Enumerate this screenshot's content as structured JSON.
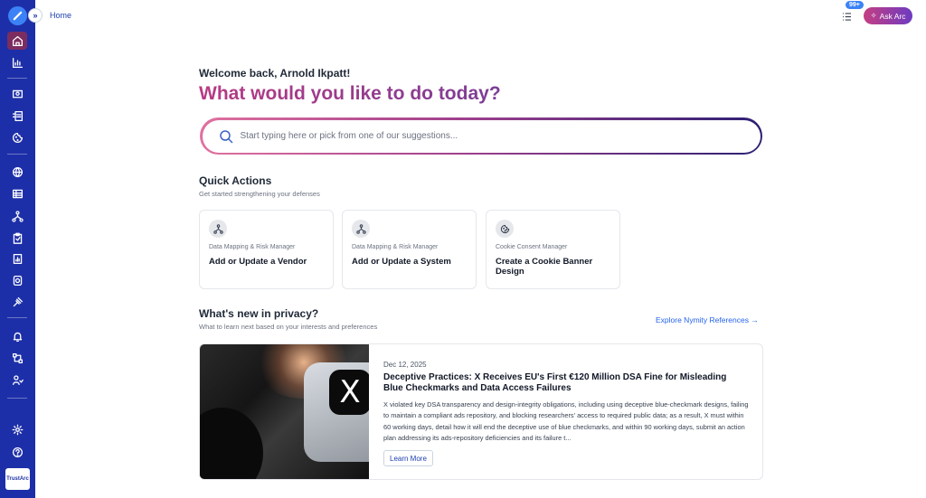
{
  "sidebar": {
    "items": [
      {
        "name": "home",
        "icon": "home-icon",
        "active": true
      },
      {
        "name": "analytics",
        "icon": "bar-chart-icon"
      },
      {
        "name": "monitor",
        "icon": "monitor-icon"
      },
      {
        "name": "reports",
        "icon": "document-icon"
      },
      {
        "name": "cookies",
        "icon": "cookie-icon"
      },
      {
        "name": "privacy",
        "icon": "globe-icon"
      },
      {
        "name": "table",
        "icon": "table-icon"
      },
      {
        "name": "data-mapping",
        "icon": "network-icon"
      },
      {
        "name": "assessments",
        "icon": "clipboard-icon"
      },
      {
        "name": "files",
        "icon": "file-chart-icon"
      },
      {
        "name": "consent",
        "icon": "shield-icon"
      },
      {
        "name": "legal",
        "icon": "gavel-icon"
      },
      {
        "name": "notifications",
        "icon": "bell-icon"
      },
      {
        "name": "workflows",
        "icon": "workflow-icon"
      },
      {
        "name": "users",
        "icon": "users-icon"
      },
      {
        "name": "settings",
        "icon": "gear-icon"
      },
      {
        "name": "help",
        "icon": "help-icon"
      }
    ],
    "brand": "TrustArc"
  },
  "header": {
    "breadcrumb": "Home",
    "notification_badge": "99+",
    "ask_label": "Ask Arc"
  },
  "hero": {
    "welcome": "Welcome back, Arnold Ikpatt!",
    "headline": "What would you like to do today?",
    "search_placeholder": "Start typing here or pick from one of our suggestions..."
  },
  "quick_actions": {
    "title": "Quick Actions",
    "subtitle": "Get started strengthening your defenses",
    "cards": [
      {
        "category": "Data Mapping & Risk Manager",
        "title": "Add or Update a Vendor",
        "icon": "network-icon"
      },
      {
        "category": "Data Mapping & Risk Manager",
        "title": "Add or Update a System",
        "icon": "network-icon"
      },
      {
        "category": "Cookie Consent Manager",
        "title": "Create a Cookie Banner Design",
        "icon": "cookie-icon"
      }
    ]
  },
  "news": {
    "title": "What's new in privacy?",
    "subtitle": "What to learn next based on your interests and preferences",
    "explore_label": "Explore Nymity References",
    "article": {
      "date": "Dec 12, 2025",
      "headline": "Deceptive Practices: X Receives EU's First €120 Million DSA Fine for Misleading Blue Checkmarks and Data Access Failures",
      "body": "X violated key DSA transparency and design-integrity obligations, including using deceptive blue-checkmark designs, failing to maintain a compliant ads repository, and blocking researchers' access to required public data; as a result, X must within 60 working days, detail how it will end the deceptive use of blue checkmarks, and within 90 working days, submit an action plan addressing its ads-repository deficiencies and its failure t...",
      "button_label": "Learn More"
    }
  },
  "colors": {
    "sidebar": "#1d2fa8",
    "active_item": "#7c2d60",
    "accent_pink": "#b83a83",
    "accent_purple": "#7a3d96",
    "link": "#2563eb"
  }
}
